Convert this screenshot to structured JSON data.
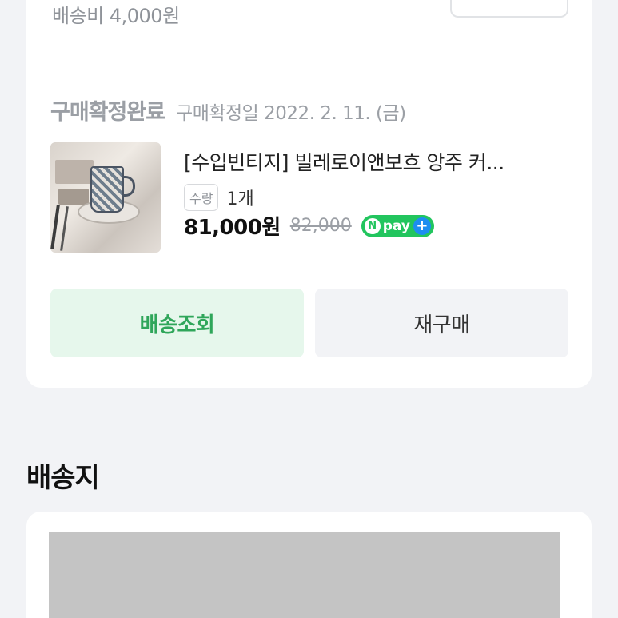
{
  "order": {
    "shipping_fee": "배송비 4,000원",
    "status_label": "구매확정완료",
    "status_date": "구매확정일 2022. 2. 11. (금)",
    "product_name": "[수입빈티지] 빌레로이앤보흐 앙주 커...",
    "qty_badge": "수량",
    "qty_value": "1개",
    "price": "81,000원",
    "original_price": "82,000",
    "npay_n": "N",
    "npay_text": "pay",
    "npay_plus": "+",
    "track_button": "배송조회",
    "rebuy_button": "재구매"
  },
  "shipping_section": {
    "title": "배송지"
  },
  "colors": {
    "background": "#f2f3f6",
    "accent_green": "#2fa65a",
    "track_button_bg": "#e6f7ec",
    "npay_green": "#22c55e",
    "npay_blue": "#1d8ef0"
  }
}
